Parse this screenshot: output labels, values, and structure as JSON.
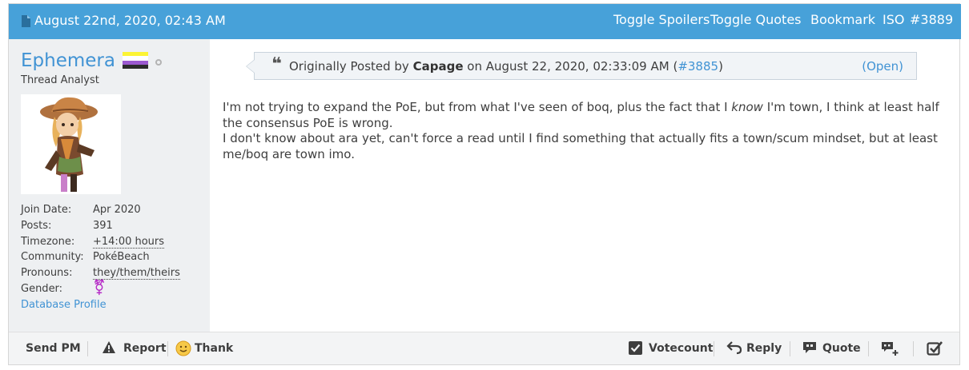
{
  "header": {
    "date": "August 22nd, 2020, 02:43 AM",
    "toggle_spoilers": "Toggle Spoilers",
    "toggle_quotes": "Toggle Quotes",
    "bookmark": "Bookmark",
    "iso": "ISO",
    "post_number": "#3889",
    "icon": "document-icon"
  },
  "user": {
    "name": "Ephemera",
    "title": "Thread Analyst",
    "flag_colors": [
      "#fcf434",
      "#ffffff",
      "#9c59d1",
      "#2c2c2c"
    ],
    "status": "offline",
    "info": [
      {
        "label": "Join Date:",
        "value": "Apr 2020"
      },
      {
        "label": "Posts:",
        "value": "391"
      },
      {
        "label": "Timezone:",
        "value": "+14:00 hours"
      },
      {
        "label": "Community:",
        "value": "PokéBeach"
      },
      {
        "label": "Pronouns:",
        "value": "they/them/theirs"
      },
      {
        "label": "Gender:",
        "value": "⚧"
      }
    ],
    "database_profile": "Database Profile"
  },
  "quote": {
    "prefix": "Originally Posted by",
    "author": "Capage",
    "on": "on",
    "date": "August 22, 2020, 02:33:09 AM",
    "post_link": "#3885",
    "open": "(Open)"
  },
  "message": {
    "line1_a": "I'm not trying to expand the PoE, but from what I've seen of boq, plus the fact that I ",
    "line1_em": "know",
    "line1_b": " I'm town, I think at least half",
    "line2": "the consensus PoE is wrong.",
    "line3": "I don't know about ara yet, can't force a read until I find something that actually fits a town/scum mindset, but at least",
    "line4": "me/boq are town imo."
  },
  "footer": {
    "send_pm": "Send PM",
    "report": "Report",
    "thank": "Thank",
    "votecount": "Votecount",
    "reply": "Reply",
    "quote": "Quote"
  },
  "colors": {
    "header_bg": "#47a1d9",
    "link": "#4193d4",
    "sidebar_bg": "#eef0f2",
    "gender": "#b528c6"
  }
}
